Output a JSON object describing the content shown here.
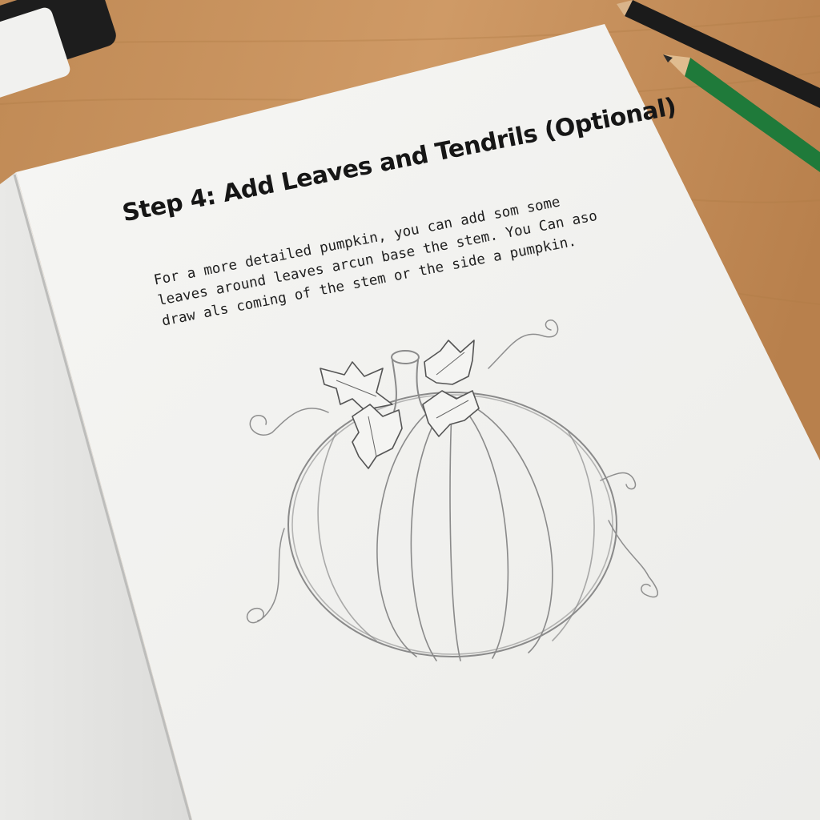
{
  "page": {
    "heading": "Step 4: Add Leaves and Tendrils (Optional)",
    "body_lines": [
      "For a more detailed pumpkin, you can add som some",
      "leaves around leaves arcun base the stem. You Can aso",
      "draw als coming of the stem or the side a pumpkin."
    ]
  },
  "colors": {
    "desk": "#c9925f",
    "paper": "#f3f3f1",
    "pencil_dark": "#1b1b1b",
    "pencil_green": "#1f7a3a",
    "sketch": "#8a8a8a"
  },
  "objects": {
    "eraser": "eraser-icon",
    "pencils": [
      "black-pencil",
      "green-pencil"
    ],
    "illustration": "pumpkin-sketch-with-leaves-and-tendrils"
  }
}
